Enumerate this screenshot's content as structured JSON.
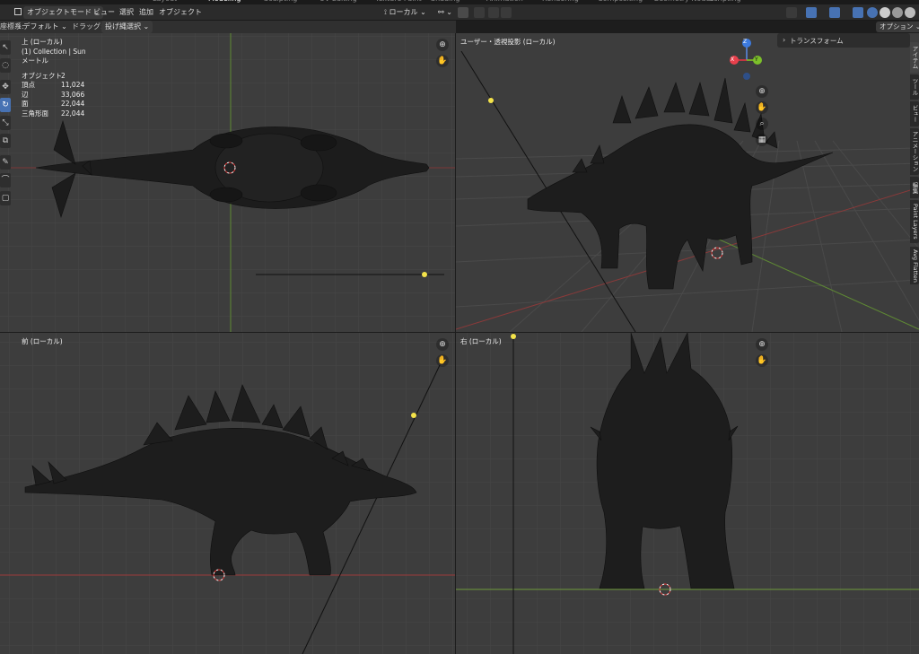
{
  "workspace_tabs": [
    "Layout",
    "Modeling",
    "Sculpting",
    "UV Editing",
    "Texture Paint",
    "Shading",
    "Animation",
    "Rendering",
    "Compositing",
    "Geometry Nodes",
    "Scripting"
  ],
  "header": {
    "mode": "オブジェクトモード",
    "menus": [
      "ビュー",
      "選択",
      "追加",
      "オブジェクト"
    ],
    "transform_orientation": "ローカル",
    "options": "オプション"
  },
  "tool_header": {
    "coord_label": "座標系:",
    "coord_value": "デフォルト",
    "drag_label": "ドラッグ:",
    "drag_value": "投げ縄選択"
  },
  "viewport_top": {
    "title": "上 (ローカル)",
    "collection": "(1) Collection | Sun",
    "unit": "メートル",
    "stats": [
      {
        "label": "オブジェクト",
        "value": "2"
      },
      {
        "label": "頂点",
        "value": "11,024"
      },
      {
        "label": "辺",
        "value": "33,066"
      },
      {
        "label": "面",
        "value": "22,044"
      },
      {
        "label": "三角形面",
        "value": "22,044"
      }
    ]
  },
  "viewport_persp": {
    "title": "ユーザー・透視投影 (ローカル)",
    "gizmo": {
      "z": "Z",
      "x": "X",
      "y": "Y"
    }
  },
  "viewport_front": {
    "title": "前 (ローカル)"
  },
  "viewport_right": {
    "title": "右 (ローカル)"
  },
  "sidebar": {
    "panel_title": "トランスフォーム",
    "tabs": [
      "アイテム",
      "ツール",
      "ビュー",
      "アニメーション",
      "編集",
      "Paint Layers",
      "Avg Flatten"
    ]
  },
  "colors": {
    "viewport_bg": "#3d3d3d",
    "grid": "#474747",
    "x_axis": "#9c3b3b",
    "y_axis": "#6e9a3a",
    "accent": "#4772b3",
    "light": "#f4e34a",
    "mesh": "#1a1a1a"
  }
}
